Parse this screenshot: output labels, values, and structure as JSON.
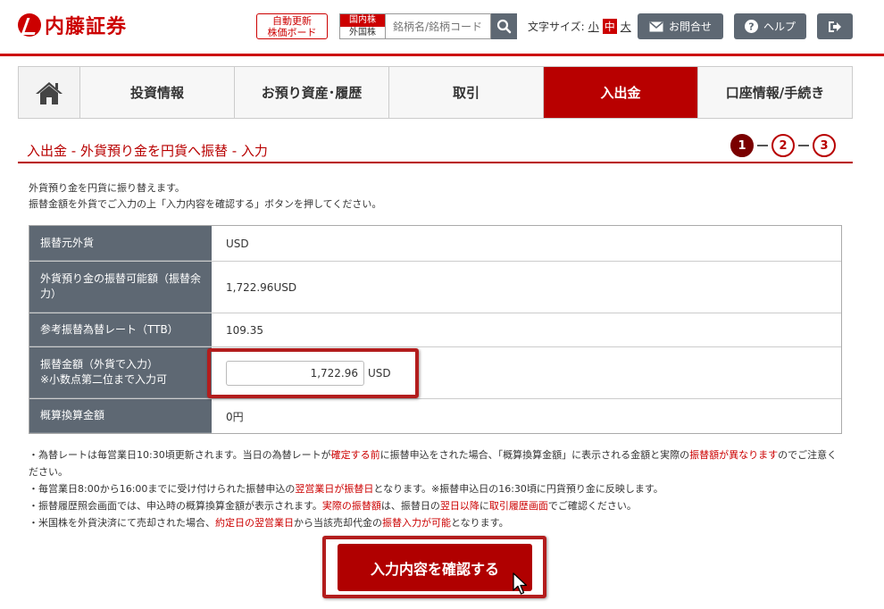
{
  "header": {
    "logo_text": "内藤証券",
    "board_line1": "自動更新",
    "board_line2": "株価ボード",
    "market_domestic": "国内株",
    "market_foreign": "外国株",
    "search_placeholder": "銘柄名/銘柄コード",
    "font_size_label": "文字サイズ:",
    "font_small": "小",
    "font_medium": "中",
    "font_large": "大",
    "contact_label": "お問合せ",
    "help_label": "ヘルプ"
  },
  "nav": {
    "items": [
      {
        "label": "投資情報"
      },
      {
        "label": "お預り資産･履歴"
      },
      {
        "label": "取引"
      },
      {
        "label": "入出金"
      },
      {
        "label": "口座情報/手続き"
      }
    ]
  },
  "page": {
    "title": "入出金 - 外貨預り金を円貨へ振替 - 入力",
    "steps": [
      "1",
      "2",
      "3"
    ],
    "intro_line1": "外貨預り金を円貨に振り替えます。",
    "intro_line2": "振替金額を外貨でご入力の上「入力内容を確認する」ボタンを押してください。"
  },
  "form": {
    "rows": [
      {
        "label": "振替元外貨",
        "value": "USD"
      },
      {
        "label": "外貨預り金の振替可能額（振替余力）",
        "value": "1,722.96USD"
      },
      {
        "label": "参考振替為替レート（TTB）",
        "value": "109.35"
      },
      {
        "label": "振替金額（外貨で入力）",
        "label2": "※小数点第二位まで入力可",
        "value": "1,722.96",
        "unit": "USD"
      },
      {
        "label": "概算換算金額",
        "value": "0円"
      }
    ]
  },
  "notes": {
    "n1a": "・為替レートは毎営業日10:30頃更新されます。当日の為替レートが",
    "n1b": "確定する前",
    "n1c": "に振替申込をされた場合、「概算換算金額」に表示される金額と実際の",
    "n1d": "振替額が異なります",
    "n1e": "のでご注意ください。",
    "n2a": "・毎営業日8:00から16:00までに受け付けられた振替申込の",
    "n2b": "翌営業日が振替日",
    "n2c": "となります。※振替申込日の16:30頃に円貨預り金に反映します。",
    "n3a": "・振替履歴照会画面では、申込時の概算換算金額が表示されます。",
    "n3b": "実際の振替額",
    "n3c": "は、振替日の",
    "n3d": "翌日以降",
    "n3e": "に",
    "n3f": "取引履歴画面",
    "n3g": "でご確認ください。",
    "n4a": "・米国株を外貨決済にて売却された場合、",
    "n4b": "約定日の翌営業日",
    "n4c": "から当該売却代金の",
    "n4d": "振替入力が可能",
    "n4e": "となります。"
  },
  "confirm": {
    "label": "入力内容を確認する"
  }
}
